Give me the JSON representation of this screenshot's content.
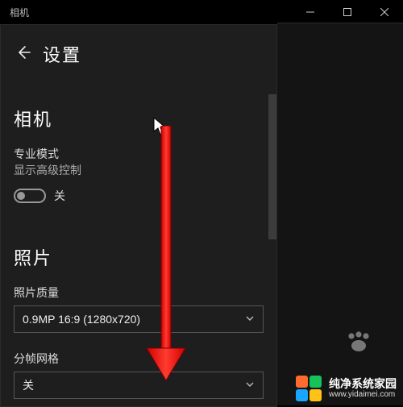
{
  "titlebar": {
    "app_name": "相机"
  },
  "header": {
    "page_title": "设置"
  },
  "sections": {
    "camera": {
      "title": "相机",
      "pro": {
        "label": "专业模式",
        "sublabel": "显示高级控制",
        "state_text": "关",
        "on": false
      }
    },
    "photo": {
      "title": "照片",
      "quality": {
        "label": "照片质量",
        "value": "0.9MP 16:9 (1280x720)"
      },
      "grid": {
        "label": "分帧网格",
        "value": "关"
      }
    }
  },
  "watermark": {
    "brand": "纯净系统家园",
    "url": "www.yidaimei.com"
  }
}
